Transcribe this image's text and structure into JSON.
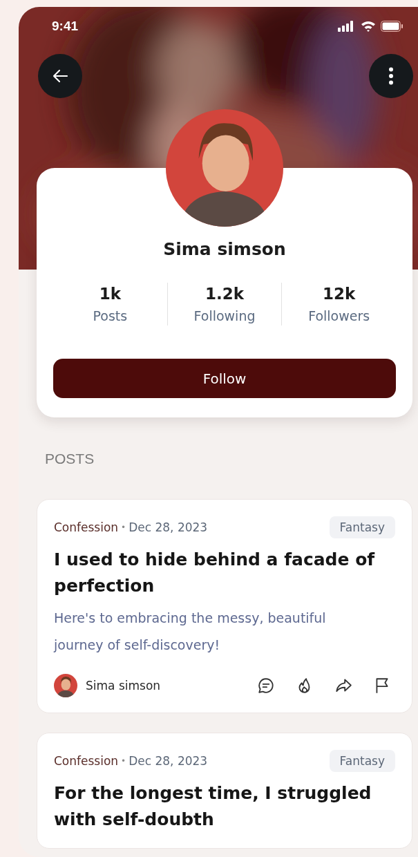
{
  "status_bar": {
    "time": "9:41"
  },
  "profile": {
    "name": "Sima simson",
    "stats": [
      {
        "value": "1k",
        "label": "Posts"
      },
      {
        "value": "1.2k",
        "label": "Following"
      },
      {
        "value": "12k",
        "label": "Followers"
      }
    ],
    "follow_button": "Follow"
  },
  "section_title": "POSTS",
  "posts": [
    {
      "category": "Confession",
      "separator": "•",
      "date": "Dec 28, 2023",
      "tag": "Fantasy",
      "title": "I used to hide behind a facade of perfection",
      "excerpt": "Here's to embracing the messy, beautiful journey of self-discovery!",
      "author": "Sima simson"
    },
    {
      "category": "Confession",
      "separator": "•",
      "date": "Dec 28, 2023",
      "tag": "Fantasy",
      "title": "For the longest time, I struggled with self-doubth"
    }
  ]
}
